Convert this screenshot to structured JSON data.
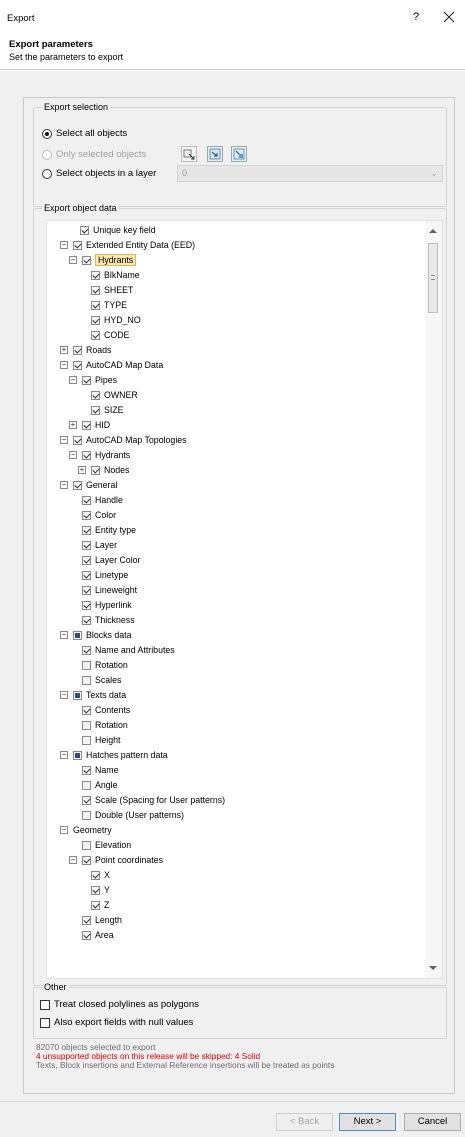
{
  "window": {
    "title": "Export",
    "help_glyph": "?",
    "close_glyph": "×"
  },
  "header": {
    "title": "Export parameters",
    "subtitle": "Set the parameters to export"
  },
  "export_selection": {
    "legend": "Export selection",
    "select_all": "Select all objects",
    "only_selected": "Only selected objects",
    "select_in_layer": "Select objects in a layer",
    "layer_value": "0",
    "selected_option": "select_all"
  },
  "export_data": {
    "legend": "Export object data",
    "tree": [
      {
        "label": "Unique key field",
        "state": "checked",
        "expander": ""
      },
      {
        "label": "Extended Entity Data (EED)",
        "state": "checked",
        "expander": "−"
      },
      {
        "label": "Hydrants",
        "state": "checked",
        "expander": "−",
        "highlight": true
      },
      {
        "label": "BlkName",
        "state": "checked",
        "expander": ""
      },
      {
        "label": "SHEET",
        "state": "checked",
        "expander": ""
      },
      {
        "label": "TYPE",
        "state": "checked",
        "expander": ""
      },
      {
        "label": "HYD_NO",
        "state": "checked",
        "expander": ""
      },
      {
        "label": "CODE",
        "state": "checked",
        "expander": ""
      },
      {
        "label": "Roads",
        "state": "checked",
        "expander": "+"
      },
      {
        "label": "AutoCAD Map Data",
        "state": "checked",
        "expander": "−"
      },
      {
        "label": "Pipes",
        "state": "checked",
        "expander": "−"
      },
      {
        "label": "OWNER",
        "state": "checked",
        "expander": ""
      },
      {
        "label": "SIZE",
        "state": "checked",
        "expander": ""
      },
      {
        "label": "HID",
        "state": "checked",
        "expander": "+"
      },
      {
        "label": "AutoCAD Map Topologies",
        "state": "checked",
        "expander": "−"
      },
      {
        "label": "Hydrants",
        "state": "checked",
        "expander": "−"
      },
      {
        "label": "Nodes",
        "state": "checked",
        "expander": "+"
      },
      {
        "label": "General",
        "state": "checked",
        "expander": "−"
      },
      {
        "label": "Handle",
        "state": "checked",
        "expander": ""
      },
      {
        "label": "Color",
        "state": "checked",
        "expander": ""
      },
      {
        "label": "Entity type",
        "state": "checked",
        "expander": ""
      },
      {
        "label": "Layer",
        "state": "checked",
        "expander": ""
      },
      {
        "label": "Layer Color",
        "state": "checked",
        "expander": ""
      },
      {
        "label": "Linetype",
        "state": "checked",
        "expander": ""
      },
      {
        "label": "Lineweight",
        "state": "checked",
        "expander": ""
      },
      {
        "label": "Hyperlink",
        "state": "checked",
        "expander": ""
      },
      {
        "label": "Thickness",
        "state": "checked",
        "expander": ""
      },
      {
        "label": "Blocks data",
        "state": "partial",
        "expander": "−"
      },
      {
        "label": "Name and Attributes",
        "state": "checked",
        "expander": ""
      },
      {
        "label": "Rotation",
        "state": "unchecked",
        "expander": ""
      },
      {
        "label": "Scales",
        "state": "unchecked",
        "expander": ""
      },
      {
        "label": "Texts data",
        "state": "partial",
        "expander": "−"
      },
      {
        "label": "Contents",
        "state": "checked",
        "expander": ""
      },
      {
        "label": "Rotation",
        "state": "unchecked",
        "expander": ""
      },
      {
        "label": "Height",
        "state": "unchecked",
        "expander": ""
      },
      {
        "label": "Hatches pattern data",
        "state": "partial",
        "expander": "−"
      },
      {
        "label": "Name",
        "state": "checked",
        "expander": ""
      },
      {
        "label": "Angle",
        "state": "unchecked",
        "expander": ""
      },
      {
        "label": "Scale (Spacing for User patterns)",
        "state": "checked",
        "expander": ""
      },
      {
        "label": "Double (User patterns)",
        "state": "unchecked",
        "expander": ""
      },
      {
        "label": "Geometry",
        "state": "none",
        "expander": "−"
      },
      {
        "label": "Elevation",
        "state": "unchecked",
        "expander": ""
      },
      {
        "label": "Point coordinates",
        "state": "checked",
        "expander": "−"
      },
      {
        "label": "X",
        "state": "checked",
        "expander": ""
      },
      {
        "label": "Y",
        "state": "checked",
        "expander": ""
      },
      {
        "label": "Z",
        "state": "checked",
        "expander": ""
      },
      {
        "label": "Length",
        "state": "checked",
        "expander": ""
      },
      {
        "label": "Area",
        "state": "checked",
        "expander": ""
      }
    ]
  },
  "other": {
    "legend": "Other",
    "closed_polylines": "Treat closed polylines as polygons",
    "null_values": "Also export fields with null values"
  },
  "status": {
    "line1": "82070 objects selected to export",
    "line2": "4 unsupported objects on this release will be skipped: 4 Solid",
    "line3": "Texts, Block insertions and External Reference insertions will be treated as points"
  },
  "buttons": {
    "back": "< Back",
    "next": "Next >",
    "cancel": "Cancel"
  }
}
